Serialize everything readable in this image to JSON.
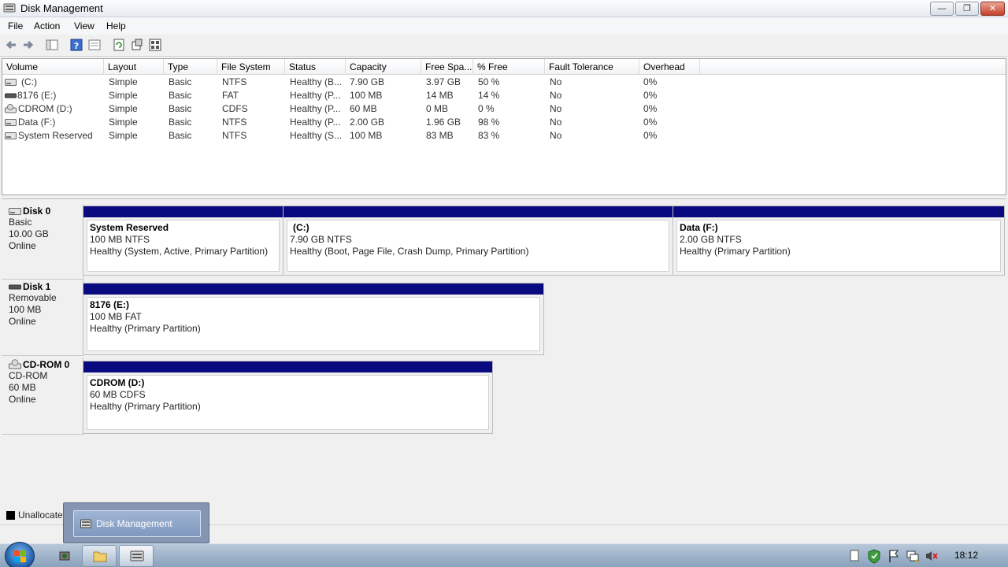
{
  "window": {
    "title": "Disk Management",
    "icon": "disk-management-icon"
  },
  "menu": [
    "File",
    "Action",
    "View",
    "Help"
  ],
  "toolbar": [
    "back-icon",
    "forward-icon",
    "show-hide-console-tree-icon",
    "help-icon",
    "properties-list-icon",
    "refresh-icon",
    "properties-icon",
    "export-icon"
  ],
  "volume_list": {
    "columns": [
      "Volume",
      "Layout",
      "Type",
      "File System",
      "Status",
      "Capacity",
      "Free Spa...",
      "% Free",
      "Fault Tolerance",
      "Overhead"
    ],
    "rows": [
      [
        "(C:)",
        "Simple",
        "Basic",
        "NTFS",
        "Healthy (B...",
        "7.90 GB",
        "3.97 GB",
        "50 %",
        "No",
        "0%"
      ],
      [
        "8176 (E:)",
        "Simple",
        "Basic",
        "FAT",
        "Healthy (P...",
        "100 MB",
        "14 MB",
        "14 %",
        "No",
        "0%"
      ],
      [
        "CDROM (D:)",
        "Simple",
        "Basic",
        "CDFS",
        "Healthy (P...",
        "60 MB",
        "0 MB",
        "0 %",
        "No",
        "0%"
      ],
      [
        "Data (F:)",
        "Simple",
        "Basic",
        "NTFS",
        "Healthy (P...",
        "2.00 GB",
        "1.96 GB",
        "98 %",
        "No",
        "0%"
      ],
      [
        "System Reserved",
        "Simple",
        "Basic",
        "NTFS",
        "Healthy (S...",
        "100 MB",
        "83 MB",
        "83 %",
        "No",
        "0%"
      ]
    ]
  },
  "disks": [
    {
      "name": "Disk 0",
      "type": "Basic",
      "size": "10.00 GB",
      "state": "Online",
      "partitions": [
        {
          "name": "System Reserved",
          "size": "100 MB NTFS",
          "status": "Healthy (System, Active, Primary Partition)"
        },
        {
          "name": "(C:)",
          "size": "7.90 GB NTFS",
          "status": "Healthy (Boot, Page File, Crash Dump, Primary Partition)"
        },
        {
          "name": "Data  (F:)",
          "size": "2.00 GB NTFS",
          "status": "Healthy (Primary Partition)"
        }
      ]
    },
    {
      "name": "Disk 1",
      "type": "Removable",
      "size": "100 MB",
      "state": "Online",
      "partitions": [
        {
          "name": "8176  (E:)",
          "size": "100 MB FAT",
          "status": "Healthy (Primary Partition)"
        }
      ]
    },
    {
      "name": "CD-ROM 0",
      "type": "CD-ROM",
      "size": "60 MB",
      "state": "Online",
      "partitions": [
        {
          "name": "CDROM  (D:)",
          "size": "60 MB CDFS",
          "status": "Healthy (Primary Partition)"
        }
      ]
    }
  ],
  "legend": {
    "label": "Unallocate"
  },
  "taskbar": {
    "preview_title": "Disk Management",
    "clock": "18:12",
    "colors": {
      "partition_bar": "#0a0a80"
    }
  }
}
